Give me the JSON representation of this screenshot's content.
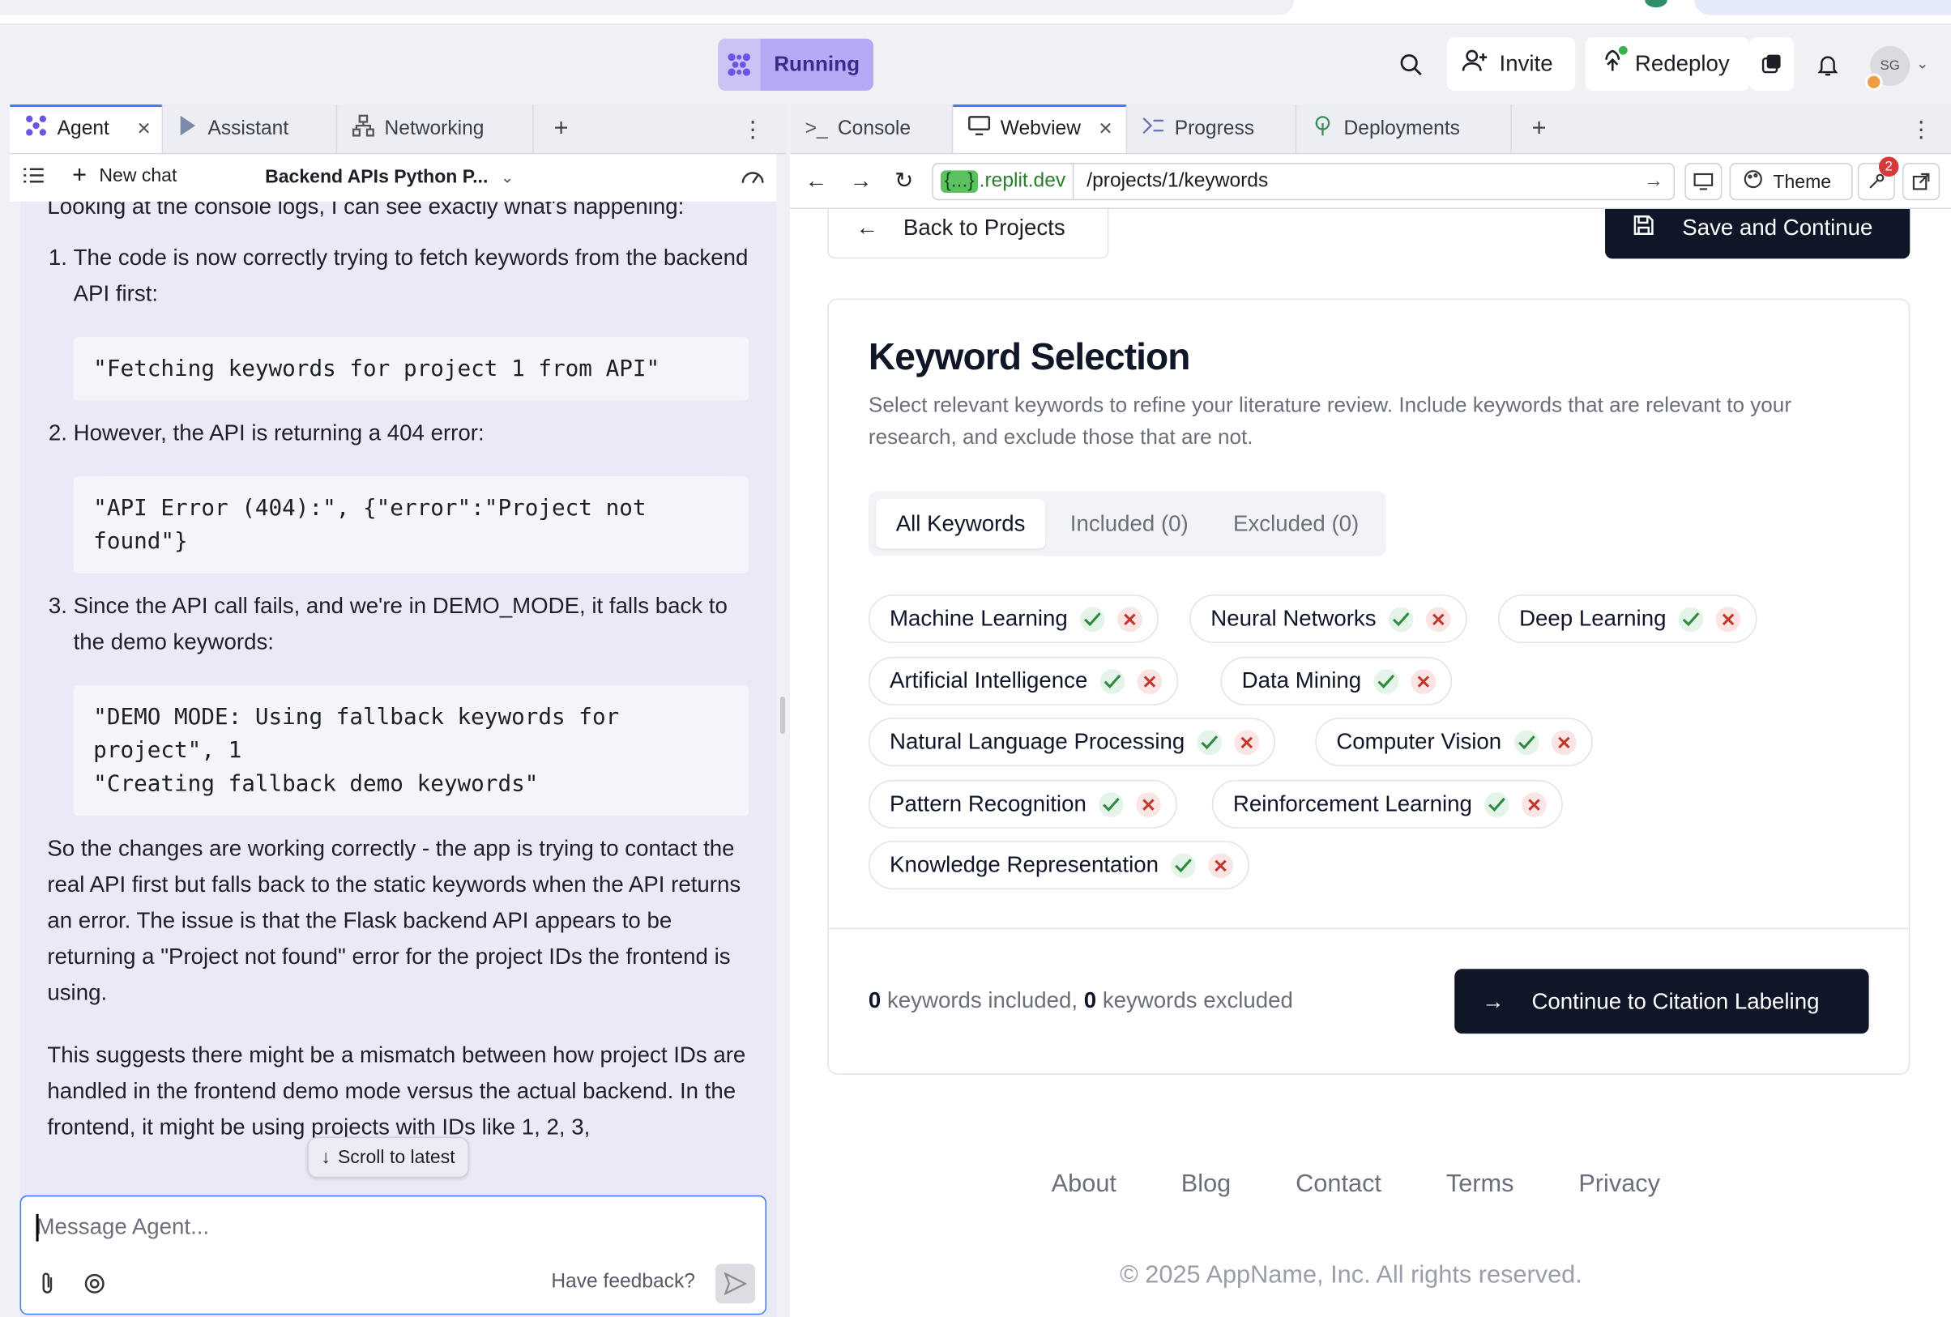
{
  "header": {
    "status_label": "Running",
    "invite_label": "Invite",
    "redeploy_label": "Redeploy",
    "avatar_initials": "SG"
  },
  "left_tabs": [
    {
      "label": "Agent",
      "active": true
    },
    {
      "label": "Assistant",
      "active": false
    },
    {
      "label": "Networking",
      "active": false
    }
  ],
  "right_tabs": [
    {
      "label": "Console",
      "active": false
    },
    {
      "label": "Webview",
      "active": true
    },
    {
      "label": "Progress",
      "active": false
    },
    {
      "label": "Deployments",
      "active": false
    }
  ],
  "agent_toolbar": {
    "new_chat_label": "New chat",
    "chat_title": "Backend APIs Python P..."
  },
  "chat": {
    "intro": "Looking at the console logs, I can see exactly what's happening:",
    "steps": [
      {
        "text": "The code is now correctly trying to fetch keywords from the backend API first:",
        "code": "\"Fetching keywords for project 1 from API\""
      },
      {
        "text": "However, the API is returning a 404 error:",
        "code": "\"API Error (404):\", {\"error\":\"Project not found\"}"
      },
      {
        "text": "Since the API call fails, and we're in DEMO_MODE, it falls back to the demo keywords:",
        "code": "\"DEMO MODE: Using fallback keywords for project\", 1\n\"Creating fallback demo keywords\""
      }
    ],
    "para1": "So the changes are working correctly - the app is trying to contact the real API first but falls back to the static keywords when the API returns an error. The issue is that the Flask backend API appears to be returning a \"Project not found\" error for the project IDs the frontend is using.",
    "para2": "This suggests there might be a mismatch between how project IDs are handled in the frontend demo mode versus the actual backend. In the frontend, it might be using projects with IDs like 1, 2, 3,",
    "scroll_label": "Scroll to latest",
    "input_placeholder": "Message Agent...",
    "feedback_label": "Have feedback?"
  },
  "webview": {
    "url_host": ".replit.dev",
    "url_host_prefix": "{...}",
    "url_path": "/projects/1/keywords",
    "theme_label": "Theme",
    "notification_count": "2"
  },
  "page": {
    "back_label": "Back to Projects",
    "save_label": "Save and Continue",
    "title": "Keyword Selection",
    "description": "Select relevant keywords to refine your literature review. Include keywords that are relevant to your research, and exclude those that are not.",
    "filters": [
      "All Keywords",
      "Included (0)",
      "Excluded (0)"
    ],
    "keywords": [
      "Machine Learning",
      "Neural Networks",
      "Deep Learning",
      "Artificial Intelligence",
      "Data Mining",
      "Natural Language Processing",
      "Computer Vision",
      "Pattern Recognition",
      "Reinforcement Learning",
      "Knowledge Representation"
    ],
    "included_count": "0",
    "included_text": " keywords included, ",
    "excluded_count": "0",
    "excluded_text": " keywords excluded",
    "continue_label": "Continue to Citation Labeling",
    "footer_links": [
      "About",
      "Blog",
      "Contact",
      "Terms",
      "Privacy"
    ],
    "copyright": "© 2025 AppName, Inc. All rights reserved."
  },
  "colors": {
    "accent": "#3d7bff",
    "running_bg": "#b5aaf6",
    "primary_dark": "#0f1628",
    "chat_bg": "#e9e9f7",
    "check_green": "#2e8a3e",
    "x_red": "#c0392b"
  }
}
